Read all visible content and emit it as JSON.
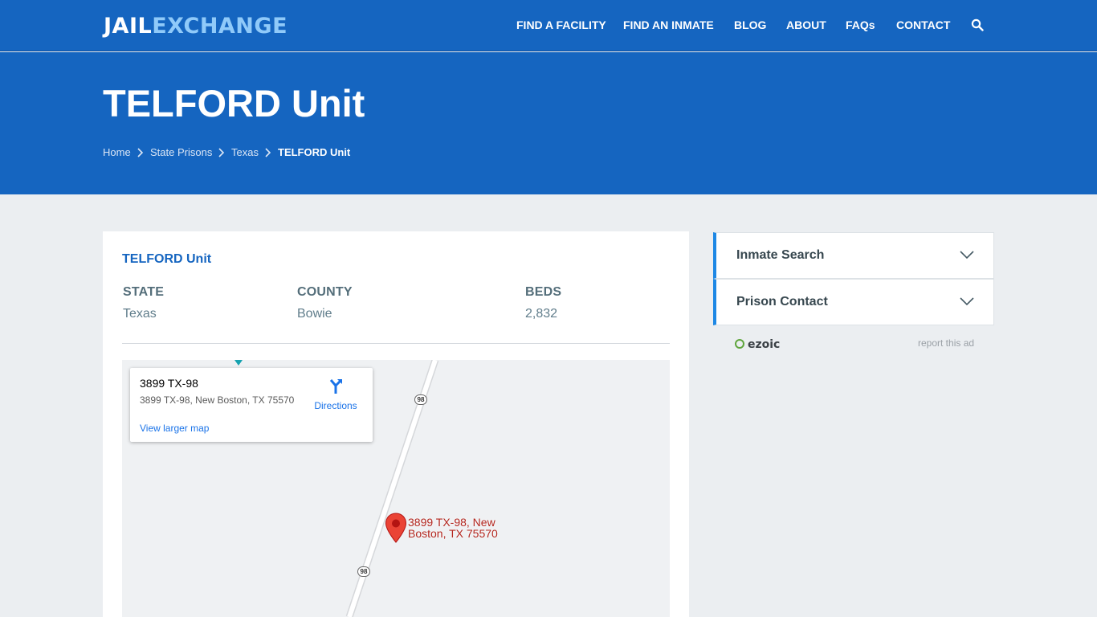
{
  "header": {
    "logo_part1": "JAIL",
    "logo_part2": "EXCHANGE",
    "nav": [
      "FIND A FACILITY",
      "FIND AN INMATE",
      "BLOG",
      "ABOUT",
      "FAQs",
      "CONTACT"
    ],
    "search_icon": "search-icon"
  },
  "hero": {
    "title": "TELFORD Unit",
    "breadcrumb": [
      "Home",
      "State Prisons",
      "Texas",
      "TELFORD Unit"
    ]
  },
  "facility": {
    "name": "TELFORD Unit",
    "state_label": "STATE",
    "state_value": "Texas",
    "county_label": "COUNTY",
    "county_value": "Bowie",
    "beds_label": "BEDS",
    "beds_value": "2,832"
  },
  "map": {
    "infobox_title": "3899 TX-98",
    "infobox_address": "3899 TX-98, New Boston, TX 75570",
    "directions_label": "Directions",
    "larger_map_link": "View larger map",
    "pin_label": "3899 TX-98, New Boston, TX 75570",
    "route_shield": "98"
  },
  "sidebar": {
    "accordions": [
      "Inmate Search",
      "Prison Contact"
    ],
    "ad_brand": "ezoic",
    "report_ad": "report this ad"
  },
  "colors": {
    "brand_blue": "#1565c0",
    "logo_accent": "#90caf9",
    "accordion_accent": "#1e88e5",
    "pin_red": "#ea4335"
  }
}
